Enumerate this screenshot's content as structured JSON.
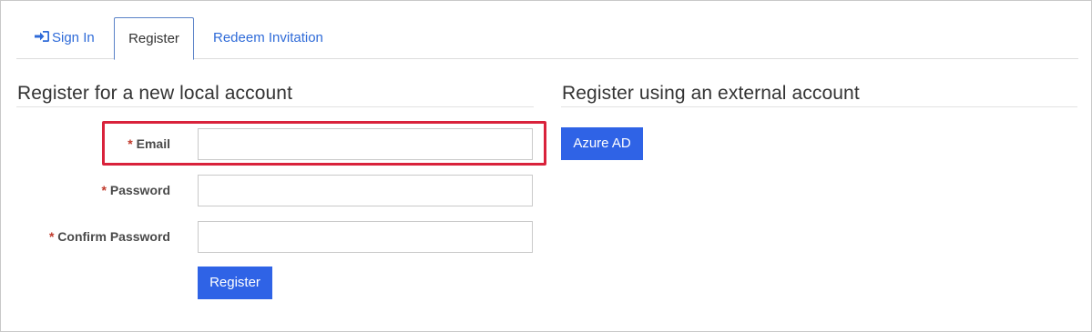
{
  "tabs": {
    "signin": "Sign In",
    "register": "Register",
    "redeem": "Redeem Invitation"
  },
  "local": {
    "title": "Register for a new local account",
    "required_marker": "*",
    "email_label": "Email",
    "email_value": "",
    "password_label": "Password",
    "password_value": "",
    "confirm_label": "Confirm Password",
    "confirm_value": "",
    "register_button": "Register"
  },
  "external": {
    "title": "Register using an external account",
    "azure_button": "Azure AD"
  },
  "colors": {
    "accent": "#2f63e6",
    "link": "#2f6bd8",
    "highlight": "#d9223b",
    "required": "#c0392b"
  },
  "icons": {
    "signin": "sign-in-icon"
  }
}
